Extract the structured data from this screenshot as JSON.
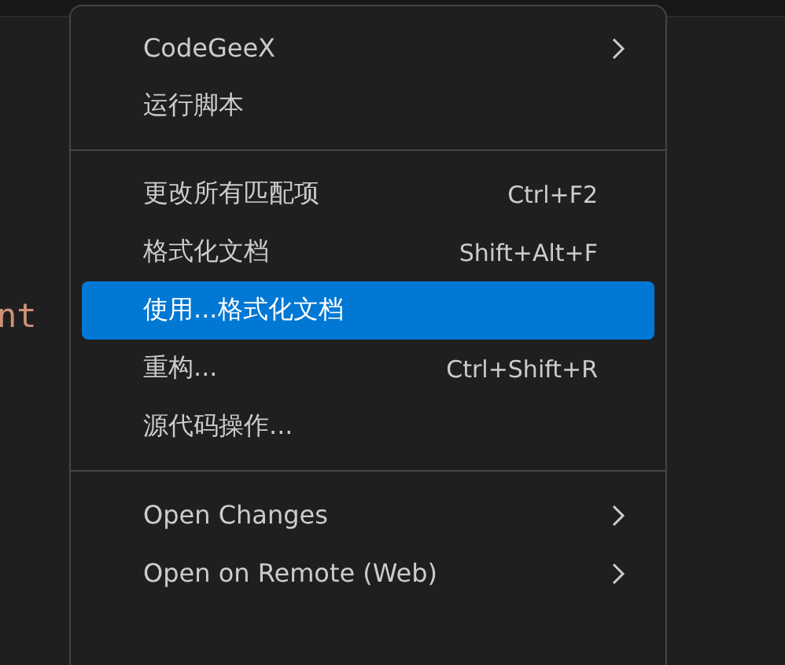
{
  "editor": {
    "code_fragment": "nt"
  },
  "menu": {
    "groups": [
      {
        "items": [
          {
            "label": "CodeGeeX",
            "submenu": true,
            "selected": false
          },
          {
            "label": "运行脚本",
            "submenu": false,
            "selected": false
          }
        ]
      },
      {
        "items": [
          {
            "label": "更改所有匹配项",
            "shortcut": "Ctrl+F2",
            "submenu": false,
            "selected": false
          },
          {
            "label": "格式化文档",
            "shortcut": "Shift+Alt+F",
            "submenu": false,
            "selected": false
          },
          {
            "label": "使用...格式化文档",
            "submenu": false,
            "selected": true
          },
          {
            "label": "重构...",
            "shortcut": "Ctrl+Shift+R",
            "submenu": false,
            "selected": false
          },
          {
            "label": "源代码操作...",
            "submenu": false,
            "selected": false
          }
        ]
      },
      {
        "items": [
          {
            "label": "Open Changes",
            "submenu": true,
            "selected": false
          },
          {
            "label": "Open on Remote (Web)",
            "submenu": true,
            "selected": false
          }
        ]
      }
    ]
  }
}
